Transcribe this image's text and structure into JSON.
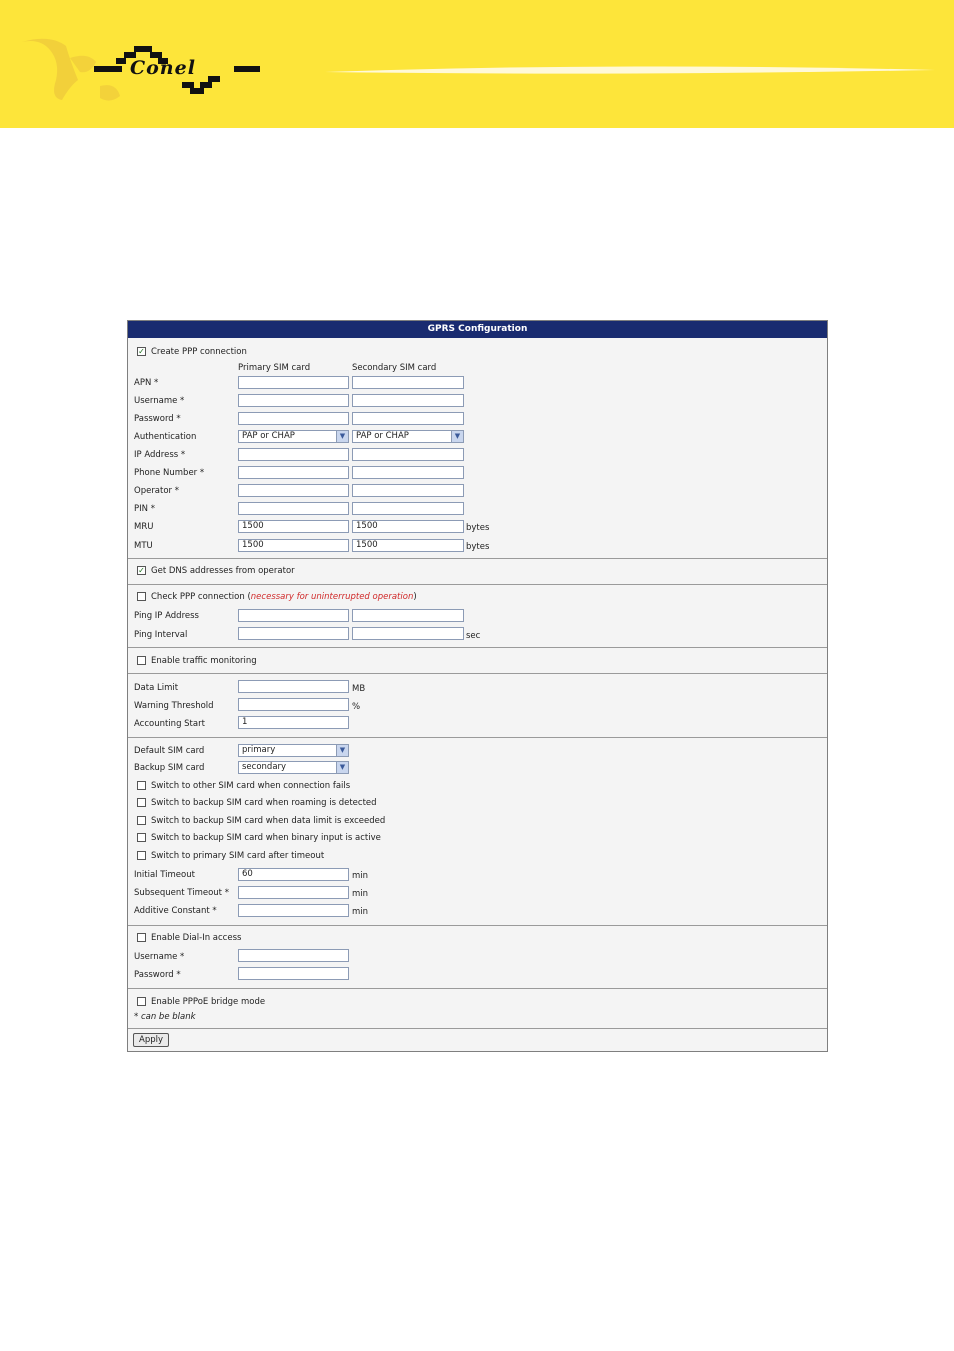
{
  "header": {
    "logo_text": "Conel"
  },
  "panel_title": "GPRS Configuration",
  "ppp": {
    "create_label": "Create PPP connection",
    "create_checked": true,
    "col_primary": "Primary SIM card",
    "col_secondary": "Secondary SIM card",
    "fields": {
      "apn": "APN *",
      "username": "Username *",
      "password": "Password *",
      "authentication": "Authentication",
      "ip_address": "IP Address *",
      "phone_number": "Phone Number *",
      "operator": "Operator *",
      "pin": "PIN *",
      "mru": "MRU",
      "mtu": "MTU"
    },
    "auth_primary": "PAP or CHAP",
    "auth_secondary": "PAP or CHAP",
    "mru_primary": "1500",
    "mru_secondary": "1500",
    "mtu_primary": "1500",
    "mtu_secondary": "1500",
    "unit_bytes": "bytes"
  },
  "dns": {
    "label": "Get DNS addresses from operator",
    "checked": true
  },
  "check": {
    "label": "Check PPP connection",
    "note_open": "(",
    "note": "necessary for uninterrupted operation",
    "note_close": ")",
    "ping_ip": "Ping IP Address",
    "ping_interval": "Ping Interval",
    "unit_sec": "sec"
  },
  "traffic": {
    "label": "Enable traffic monitoring"
  },
  "data_limit": {
    "limit": "Data Limit",
    "warning": "Warning Threshold",
    "accounting": "Accounting Start",
    "unit_mb": "MB",
    "unit_pct": "%",
    "accounting_value": "1"
  },
  "sim": {
    "default": "Default SIM card",
    "backup": "Backup SIM card",
    "default_value": "primary",
    "backup_value": "secondary",
    "opt1": "Switch to other SIM card when connection fails",
    "opt2": "Switch to backup SIM card when roaming is detected",
    "opt3": "Switch to backup SIM card when data limit is exceeded",
    "opt4": "Switch to backup SIM card when binary input is active",
    "opt5": "Switch to primary SIM card after timeout",
    "initial_timeout": "Initial Timeout",
    "subsequent_timeout": "Subsequent Timeout *",
    "additive_constant": "Additive Constant *",
    "initial_value": "60",
    "unit_min": "min"
  },
  "dialin": {
    "label": "Enable Dial-In access",
    "username": "Username *",
    "password": "Password *"
  },
  "pppoe": {
    "label": "Enable PPPoE bridge mode",
    "note": "* can be blank"
  },
  "apply_label": "Apply",
  "check_glyph": "✓",
  "arrow_glyph": "▼"
}
